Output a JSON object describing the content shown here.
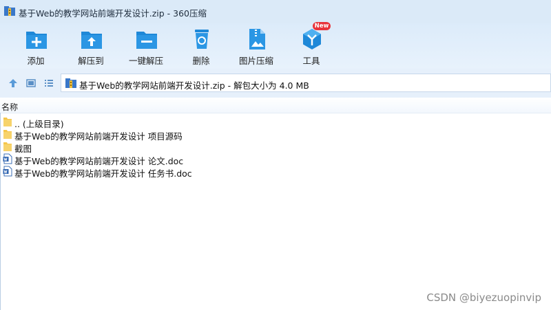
{
  "window": {
    "title": "基于Web的教学网站前端开发设计.zip - 360压缩",
    "app_icon": "archive-icon"
  },
  "toolbar": {
    "items": [
      {
        "label": "添加",
        "icon": "add-icon"
      },
      {
        "label": "解压到",
        "icon": "extract-to-icon"
      },
      {
        "label": "一键解压",
        "icon": "one-click-extract-icon"
      },
      {
        "label": "删除",
        "icon": "delete-icon"
      },
      {
        "label": "图片压缩",
        "icon": "image-compress-icon"
      },
      {
        "label": "工具",
        "icon": "tools-icon"
      }
    ],
    "new_badge": "New"
  },
  "address": {
    "text": "基于Web的教学网站前端开发设计.zip - 解包大小为 4.0 MB"
  },
  "columns": {
    "name": "名称"
  },
  "files": [
    {
      "name": ".. (上级目录)",
      "type": "folder"
    },
    {
      "name": "基于Web的教学网站前端开发设计 项目源码",
      "type": "folder"
    },
    {
      "name": "截图",
      "type": "folder"
    },
    {
      "name": "基于Web的教学网站前端开发设计 论文.doc",
      "type": "doc"
    },
    {
      "name": "基于Web的教学网站前端开发设计 任务书.doc",
      "type": "doc"
    }
  ],
  "watermark": "CSDN @biyezuopinvip",
  "colors": {
    "accent": "#1e88d8",
    "title_bg": "#dbeaf8",
    "folder": "#f5c64a",
    "badge": "#e8333a"
  }
}
